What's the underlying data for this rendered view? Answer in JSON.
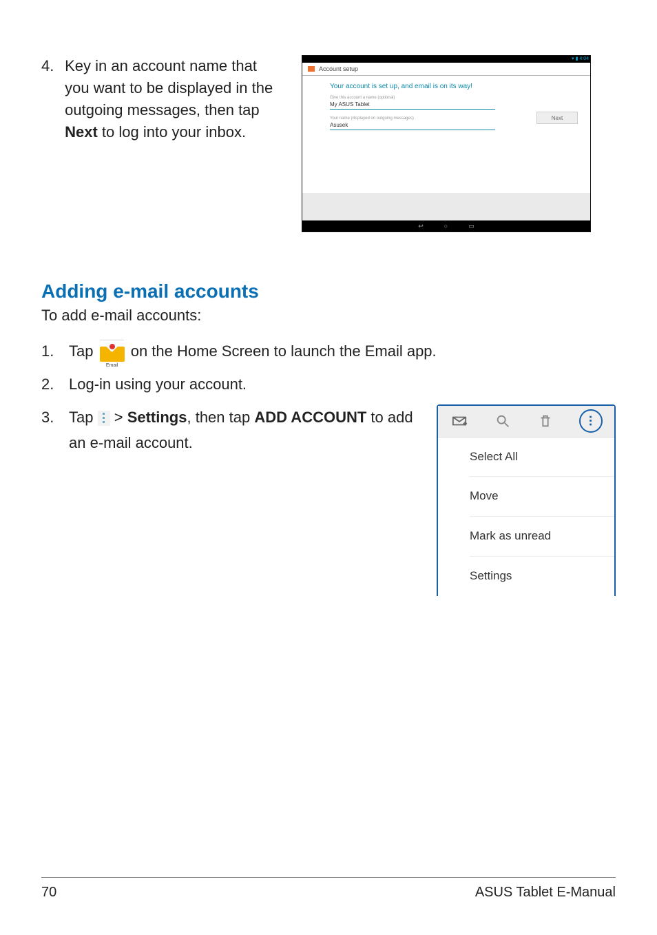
{
  "step4": {
    "number": "4.",
    "text_before": "Key in an account name that you want to be displayed in the outgoing messages, then tap ",
    "bold": "Next",
    "text_after": " to log into your inbox."
  },
  "shot1": {
    "status_right": "▾ ▮ 4:04",
    "header_title": "Account setup",
    "heading": "Your account is set up, and email is on its way!",
    "field1_label": "Give this account a name (optional)",
    "field1_value": "My ASUS Tablet",
    "field2_label": "Your name (displayed on outgoing messages)",
    "field2_value": "Asusek",
    "next_btn": "Next",
    "nav": {
      "back": "↩",
      "home": "○",
      "recent": "▭"
    }
  },
  "section": {
    "title": "Adding e-mail accounts",
    "sub": "To add e-mail accounts:"
  },
  "steps": {
    "s1": {
      "n": "1.",
      "before": "Tap ",
      "icon_caption": "Email",
      "after": " on the Home Screen to launch the Email app."
    },
    "s2": {
      "n": "2.",
      "text": "Log-in using your account."
    },
    "s3": {
      "n": "3.",
      "before": "Tap ",
      "mid": " > ",
      "bold1": "Settings",
      "mid2": ", then tap ",
      "bold2": "ADD ACCOUNT",
      "after": " to add an e-mail account."
    }
  },
  "shot2": {
    "menu": [
      "Select All",
      "Move",
      "Mark as unread",
      "Settings"
    ]
  },
  "footer": {
    "page": "70",
    "title": "ASUS Tablet E-Manual"
  }
}
